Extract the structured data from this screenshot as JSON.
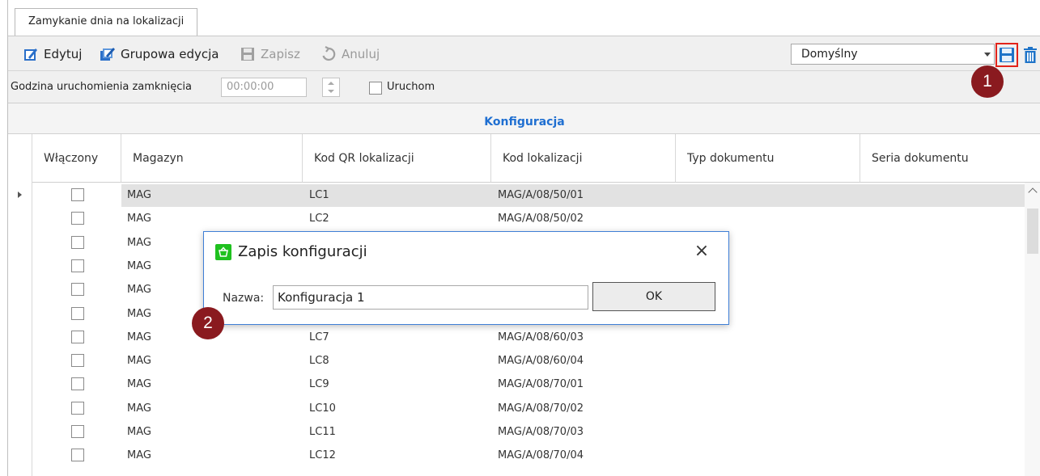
{
  "tab": {
    "label": "Zamykanie dnia na lokalizacji"
  },
  "toolbar": {
    "edit_label": "Edytuj",
    "group_edit_label": "Grupowa edycja",
    "save_label": "Zapisz",
    "cancel_label": "Anuluj",
    "config_select_value": "Domyślny",
    "icons": [
      "edit-icon",
      "group-edit-icon",
      "save-disk-icon",
      "undo-icon",
      "save-config-icon",
      "delete-config-icon"
    ]
  },
  "params": {
    "run_time_label": "Godzina uruchomienia zamknięcia",
    "run_time_value": "00:00:00",
    "run_label": "Uruchom"
  },
  "grid": {
    "group_title": "Konfiguracja",
    "columns": [
      "Włączony",
      "Magazyn",
      "Kod QR lokalizacji",
      "Kod lokalizacji",
      "Typ dokumentu",
      "Seria dokumentu"
    ],
    "rows": [
      {
        "warehouse": "MAG",
        "qr": "LC1",
        "code": "MAG/A/08/50/01"
      },
      {
        "warehouse": "MAG",
        "qr": "LC2",
        "code": "MAG/A/08/50/02"
      },
      {
        "warehouse": "MAG",
        "qr": "",
        "code": ""
      },
      {
        "warehouse": "MAG",
        "qr": "",
        "code": ""
      },
      {
        "warehouse": "MAG",
        "qr": "",
        "code": ""
      },
      {
        "warehouse": "MAG",
        "qr": "",
        "code": ""
      },
      {
        "warehouse": "MAG",
        "qr": "LC7",
        "code": "MAG/A/08/60/03"
      },
      {
        "warehouse": "MAG",
        "qr": "LC8",
        "code": "MAG/A/08/60/04"
      },
      {
        "warehouse": "MAG",
        "qr": "LC9",
        "code": "MAG/A/08/70/01"
      },
      {
        "warehouse": "MAG",
        "qr": "LC10",
        "code": "MAG/A/08/70/02"
      },
      {
        "warehouse": "MAG",
        "qr": "LC11",
        "code": "MAG/A/08/70/03"
      },
      {
        "warehouse": "MAG",
        "qr": "LC12",
        "code": "MAG/A/08/70/04"
      }
    ]
  },
  "dialog": {
    "title": "Zapis konfiguracji",
    "name_label": "Nazwa:",
    "name_value": "Konfiguracja 1",
    "ok_label": "OK",
    "close_glyph": "×"
  },
  "annotations": {
    "badge_1": "1",
    "badge_2": "2"
  },
  "colors": {
    "accent_blue": "#1f6fd1",
    "badge_red": "#8a1a1f",
    "highlight_red": "#e2231a",
    "dialog_icon_green": "#1fc11f"
  }
}
